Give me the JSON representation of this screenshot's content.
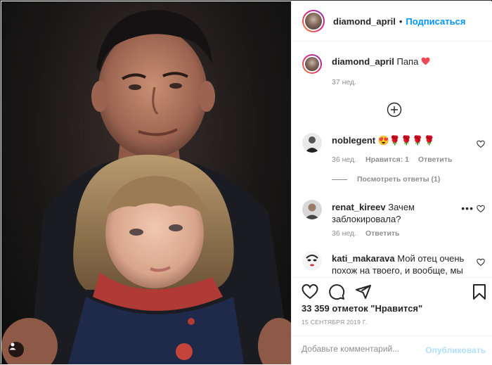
{
  "post": {
    "author": "diamond_april",
    "follow_label": "Подписаться",
    "separator": "•",
    "caption": "Папа",
    "caption_time": "37 нед."
  },
  "comments": [
    {
      "user": "noblegent",
      "text": "😍🌹🌹🌹🌹",
      "time": "36 нед.",
      "likes": "Нравится: 1",
      "reply": "Ответить",
      "view_replies": "Посмотреть ответы (1)"
    },
    {
      "user": "renat_kireev",
      "text": "Зачем заблокировала?",
      "time": "36 нед.",
      "reply": "Ответить",
      "more": "•••"
    },
    {
      "user": "kati_makarava",
      "text": "Мой отец очень похож на твоего, и вообще, мы"
    }
  ],
  "footer": {
    "likes_text": "33 359 отметок \"Нравится\"",
    "date": "15 СЕНТЯБРЯ 2019 Г.",
    "comment_placeholder": "Добавьте комментарий...",
    "publish_label": "Опубликовать"
  },
  "icons": {
    "like": "heart-icon",
    "comment": "comment-icon",
    "share": "send-icon",
    "save": "bookmark-icon",
    "load_more": "plus-circle-icon",
    "tags": "user-tag-icon"
  },
  "colors": {
    "link": "#0095f6",
    "muted": "#8e8e8e",
    "heart_red": "#ed4956",
    "publish_disabled": "#b2dffc"
  }
}
